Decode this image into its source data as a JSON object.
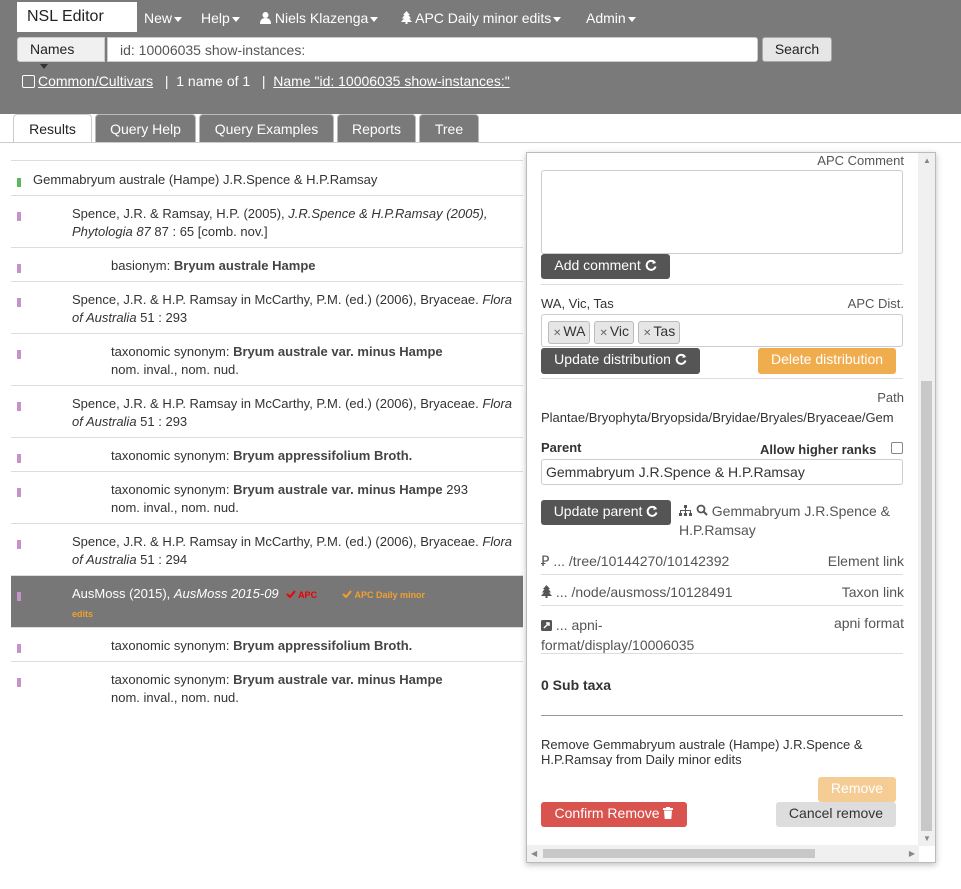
{
  "app": {
    "brand": "NSL Editor"
  },
  "nav": {
    "new": "New",
    "help": "Help",
    "user": "Niels Klazenga",
    "tree": "APC Daily minor edits",
    "admin": "Admin"
  },
  "search": {
    "type": "Names",
    "query": "id: 10006035 show-instances:",
    "button": "Search"
  },
  "info": {
    "checkbox_label": "Common/Cultivars",
    "count": "1 name of 1",
    "sep": "|",
    "link": "Name \"id: 10006035 show-instances:\""
  },
  "tabs": [
    "Results",
    "Query Help",
    "Query Examples",
    "Reports",
    "Tree"
  ],
  "results": {
    "name": "Gemmabryum australe (Hampe) J.R.Spence & H.P.Ramsay",
    "r1_pre": "Spence, J.R. & Ramsay, H.P. (2005), ",
    "r1_ital": "J.R.Spence & H.P.Ramsay (2005), Phytologia 87",
    "r1_post": " 87 : 65 [comb. nov.]",
    "r2_pre": "basionym: ",
    "r2_bold": "Bryum australe Hampe",
    "r3_pre": "Spence, J.R. & H.P. Ramsay in McCarthy, P.M. (ed.) (2006), Bryaceae. ",
    "r3_ital": "Flora of Australia",
    "r3_post": " 51 : 293",
    "r4_pre": "taxonomic synonym: ",
    "r4_bold": "Bryum australe var. minus Hampe",
    "r4_post": "nom. inval., nom. nud.",
    "r5_pre": "Spence, J.R. & H.P. Ramsay in McCarthy, P.M. (ed.) (2006), Bryaceae. ",
    "r5_ital": "Flora of Australia",
    "r5_post": " 51 : 293",
    "r6_pre": "taxonomic synonym: ",
    "r6_bold": "Bryum appressifolium Broth.",
    "r7_pre": "taxonomic synonym: ",
    "r7_bold": "Bryum australe var. minus Hampe",
    "r7_num": " 293",
    "r7_post": "nom. inval., nom. nud.",
    "r8_pre": "Spence, J.R. & H.P. Ramsay in McCarthy, P.M. (ed.) (2006), Bryaceae. ",
    "r8_ital": "Flora of Australia",
    "r8_post": " 51 : 294",
    "r9_pre": "AusMoss (2015), ",
    "r9_ital": "AusMoss 2015-09",
    "r9_apc": "APC",
    "r9_tree_1": "APC Daily minor",
    "r9_tree_2": "edits",
    "r10_pre": "taxonomic synonym: ",
    "r10_bold": "Bryum appressifolium Broth.",
    "r11_pre": "taxonomic synonym: ",
    "r11_bold": "Bryum australe var. minus Hampe",
    "r11_post": "nom. inval., nom. nud."
  },
  "panel": {
    "apc_comment_label": "APC Comment",
    "add_comment": "Add comment",
    "dist_current": "WA, Vic, Tas",
    "apc_dist_label": "APC Dist.",
    "tags": [
      "WA",
      "Vic",
      "Tas"
    ],
    "update_distribution": "Update distribution",
    "delete_distribution": "Delete distribution",
    "path_label": "Path",
    "path_value": "Plantae/Bryophyta/Bryopsida/Bryidae/Bryales/Bryaceae/Gem",
    "parent_label": "Parent",
    "allow_higher": "Allow higher ranks",
    "parent_value": "Gemmabryum J.R.Spence & H.P.Ramsay",
    "update_parent": "Update parent",
    "parent_link_1": "Gemmabryum J.R.Spence &",
    "parent_link_2": "H.P.Ramsay",
    "element_link_val": "... /tree/10144270/10142392",
    "element_link_label": "Element link",
    "taxon_link_val": "... /node/ausmoss/10128491",
    "taxon_link_label": "Taxon link",
    "apni_val_1": "... apni-",
    "apni_val_2": "format/display/10006035",
    "apni_label": "apni format",
    "sub_taxa": "0 Sub taxa",
    "remove_msg_1": "Remove Gemmabryum australe (Hampe) J.R.Spence &",
    "remove_msg_2": "H.P.Ramsay from Daily minor edits",
    "remove": "Remove",
    "confirm_remove": "Confirm Remove",
    "cancel_remove": "Cancel remove"
  }
}
